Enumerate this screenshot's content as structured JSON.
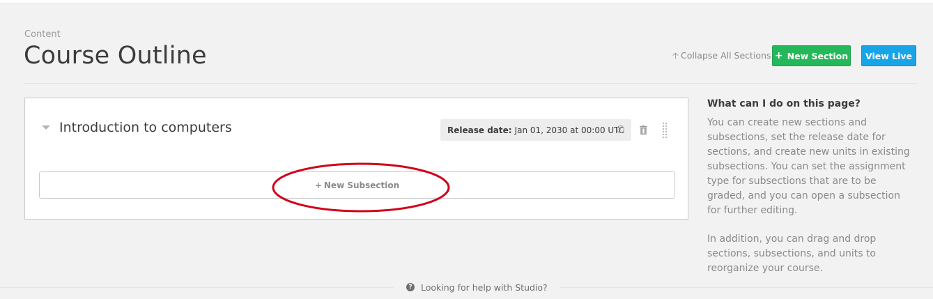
{
  "header": {
    "subtitle": "Content",
    "title": "Course Outline",
    "collapse_label": "Collapse All Sections",
    "new_section_label": "New Section",
    "view_live_label": "View Live"
  },
  "section": {
    "title": "Introduction to computers",
    "release_label": "Release date:",
    "release_value": "Jan 01, 2030 at 00:00 UTC",
    "new_subsection_label": "New Subsection"
  },
  "help": {
    "title": "What can I do on this page?",
    "paragraphs": [
      "You can create new sections and subsections, set the release date for sections, and create new units in existing subsections. You can set the assignment type for subsections that are to be graded, and you can open a subsection for further editing.",
      "In addition, you can drag and drop sections, subsections, and units to reorganize your course."
    ]
  },
  "footer": {
    "help_label": "Looking for help with Studio?"
  },
  "colors": {
    "new_section_button": "#25b85a",
    "view_live_button": "#18a5e8",
    "annotation_ellipse": "#d0021b"
  },
  "icons": [
    "arrow-up-icon",
    "plus-icon",
    "chevron-down-icon",
    "clock-icon",
    "trash-icon",
    "drag-handle-icon",
    "question-circle-icon"
  ]
}
